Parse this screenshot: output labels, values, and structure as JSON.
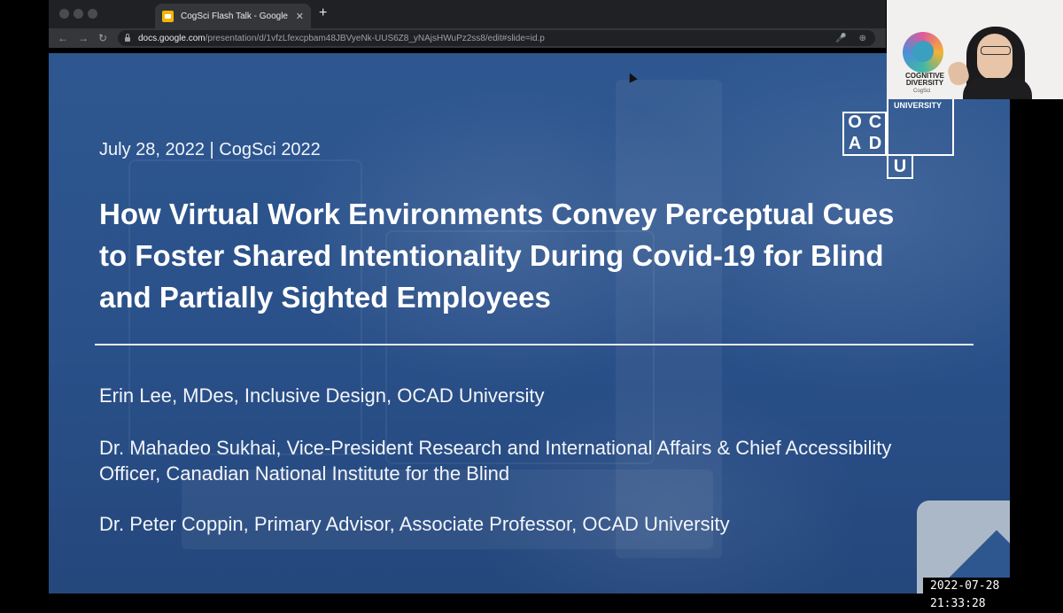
{
  "browser": {
    "tab_title": "CogSci Flash Talk - Google Slides",
    "url_domain": "docs.google.com",
    "url_path": "/presentation/d/1vfzLfexcpbam48JBVyeNk-UUS6Z8_yNAjsHWuPz2ss8/edit#slide=id.p",
    "icons": {
      "back": "back-arrow-icon",
      "forward": "forward-arrow-icon",
      "reload": "reload-icon",
      "mic": "microphone-icon",
      "zoom": "zoom-icon",
      "close_tab": "close-icon",
      "new_tab": "plus-icon"
    }
  },
  "slide": {
    "date_line": "July 28, 2022   |   CogSci 2022",
    "title": "How Virtual Work Environments Convey Perceptual Cues to Foster Shared Intentionality During Covid-19 for Blind and Partially Sighted Employees",
    "authors": [
      "Erin Lee, MDes, Inclusive Design, OCAD University",
      "Dr. Mahadeo Sukhai, Vice-President Research and International Affairs & Chief Accessibility Officer, Canadian National Institute for the Blind",
      "Dr. Peter Coppin, Primary Advisor, Associate Professor, OCAD University"
    ],
    "logo": {
      "letters": [
        "O",
        "C",
        "A",
        "D",
        "U"
      ],
      "label": "UNIVERSITY"
    }
  },
  "webcam": {
    "logo_text": "COGNITIVE DIVERSITY",
    "logo_sub": "CogSci"
  },
  "timestamp": "2022-07-28  21:33:28",
  "colors": {
    "slide_blue": "#2e5790",
    "chrome_dark": "#202124",
    "chrome_toolbar": "#35363a"
  }
}
